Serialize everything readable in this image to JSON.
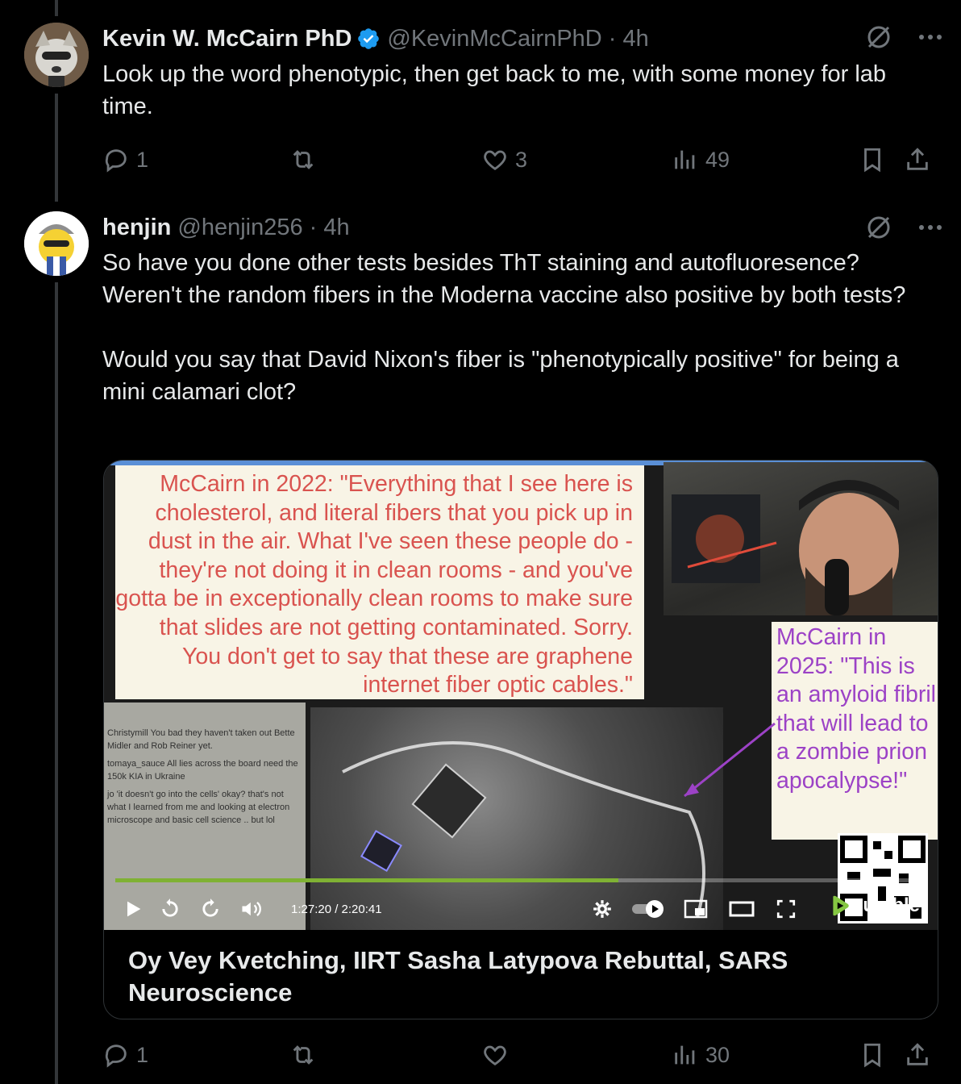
{
  "tweets": [
    {
      "name": "Kevin W. McCairn PhD",
      "verified": true,
      "handle": "@KevinMcCairnPhD",
      "time": "· 4h",
      "text": "Look up the word phenotypic, then get back to me, with some money for lab time.",
      "replies": "1",
      "likes": "3",
      "views": "49"
    },
    {
      "name": "henjin",
      "handle": "@henjin256",
      "time": "· 4h",
      "text": "So have you done other tests besides ThT staining and autofluoresence? Weren't the random fibers in the Moderna vaccine also positive by both tests?\n\nWould you say that David Nixon's fiber is \"phenotypically positive\" for being a mini calamari clot?",
      "replies": "1",
      "likes": "",
      "views": "30",
      "card": {
        "title": "Oy Vey Kvetching, IIRT Sasha Latypova Rebuttal, SARS Neuroscience",
        "quote_left": "McCairn in 2022: \"Everything that I see here is cholesterol, and literal fibers that you pick up in dust in the air. What I've seen these people do - they're not doing it in clean rooms - and you've gotta be in exceptionally clean rooms to make sure that slides are not getting contaminated. Sorry. You don't get to say that these are graphene internet fiber optic cables.\"",
        "quote_right": "McCairn in 2025: \"This is an amyloid fibril that will lead to a zombie prion apocalypse!\"",
        "time_display": "1:27:20 / 2:20:41",
        "progress_fraction": 0.62,
        "brand": "rumble",
        "chat_lines": [
          "Christymill  You bad they haven't taken out Bette Midler and Rob Reiner yet.",
          "tomaya_sauce  All lies across the board need the 150k KIA in Ukraine",
          "jo 'it doesn't go into the cells' okay? that's not what I learned from me and looking at electron microscope and basic cell science .. but lol"
        ]
      }
    }
  ],
  "colors": {
    "bg": "#000000",
    "text": "#e7e9ea",
    "muted": "#71767b",
    "verified": "#1d9bf0",
    "border": "#2f3336",
    "quote_red": "#d9534f",
    "quote_purple": "#9c42c6",
    "rumble_green": "#85c742"
  },
  "icons": [
    "reply-icon",
    "retweet-icon",
    "like-icon",
    "views-icon",
    "bookmark-icon",
    "share-icon",
    "grok-icon",
    "more-icon",
    "verified-icon"
  ]
}
